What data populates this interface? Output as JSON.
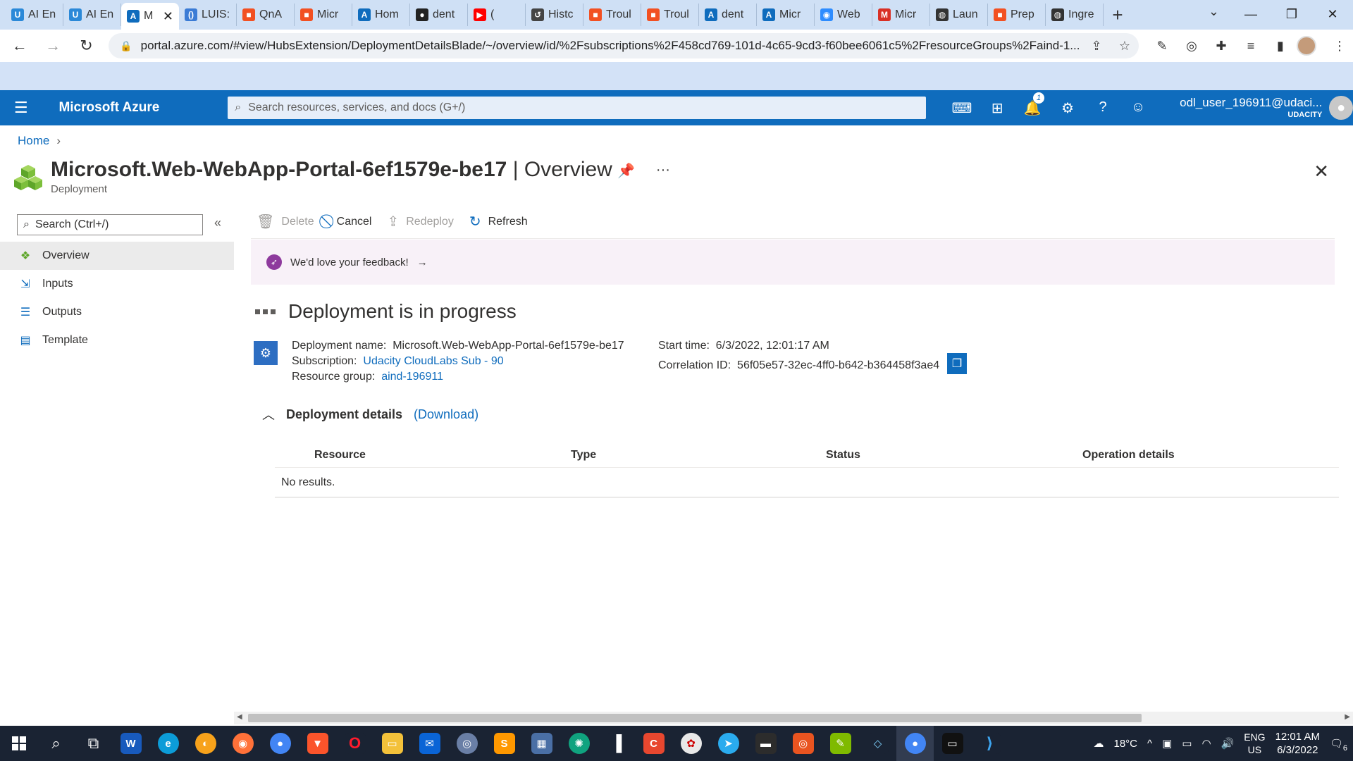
{
  "browser": {
    "tabs": [
      {
        "title": "AI En",
        "icon": "udacity-icon",
        "color": "#2b89d8",
        "glyph": "U"
      },
      {
        "title": "AI En",
        "icon": "udacity-icon",
        "color": "#2b89d8",
        "glyph": "U"
      },
      {
        "title": "M",
        "icon": "azure-icon",
        "color": "#0f6cbd",
        "glyph": "A",
        "active": true
      },
      {
        "title": "LUIS:",
        "icon": "luis-icon",
        "color": "#3a7bd5",
        "glyph": "()"
      },
      {
        "title": "QnA",
        "icon": "microsoft-icon",
        "color": "#f25022",
        "glyph": "■"
      },
      {
        "title": "Micr",
        "icon": "microsoft-icon",
        "color": "#f25022",
        "glyph": "■"
      },
      {
        "title": "Hom",
        "icon": "azure-icon",
        "color": "#0f6cbd",
        "glyph": "A"
      },
      {
        "title": "dent",
        "icon": "github-icon",
        "color": "#222222",
        "glyph": "●"
      },
      {
        "title": "(",
        "icon": "youtube-icon",
        "color": "#ff0000",
        "glyph": "▶"
      },
      {
        "title": "Histc",
        "icon": "history-icon",
        "color": "#444444",
        "glyph": "↺"
      },
      {
        "title": "Troul",
        "icon": "microsoft-icon",
        "color": "#f25022",
        "glyph": "■"
      },
      {
        "title": "Troul",
        "icon": "microsoft-icon",
        "color": "#f25022",
        "glyph": "■"
      },
      {
        "title": "dent",
        "icon": "azure-icon",
        "color": "#0f6cbd",
        "glyph": "A"
      },
      {
        "title": "Micr",
        "icon": "azure-icon",
        "color": "#0f6cbd",
        "glyph": "A"
      },
      {
        "title": "Web",
        "icon": "zoom-icon",
        "color": "#2d8cff",
        "glyph": "◉"
      },
      {
        "title": "Micr",
        "icon": "gmail-icon",
        "color": "#d93025",
        "glyph": "M"
      },
      {
        "title": "Laun",
        "icon": "globe-icon",
        "color": "#333333",
        "glyph": "◍"
      },
      {
        "title": "Prep",
        "icon": "microsoft-icon",
        "color": "#f25022",
        "glyph": "■"
      },
      {
        "title": "Ingre",
        "icon": "globe-icon",
        "color": "#333333",
        "glyph": "◍"
      }
    ],
    "url": "portal.azure.com/#view/HubsExtension/DeploymentDetailsBlade/~/overview/id/%2Fsubscriptions%2F458cd769-101d-4c65-9cd3-f60bee6061c5%2FresourceGroups%2Faind-1..."
  },
  "azure": {
    "brand": "Microsoft Azure",
    "search_placeholder": "Search resources, services, and docs (G+/)",
    "notification_count": "1",
    "user_name": "odl_user_196911@udaci...",
    "user_org": "UDACITY"
  },
  "breadcrumb": {
    "home": "Home"
  },
  "page": {
    "title_bold": "Microsoft.Web-WebApp-Portal-6ef1579e-be17",
    "title_rest": " | Overview",
    "subtitle": "Deployment"
  },
  "menu": {
    "search_placeholder": "Search (Ctrl+/)",
    "items": [
      {
        "label": "Overview",
        "icon": "overview-icon",
        "active": true
      },
      {
        "label": "Inputs",
        "icon": "inputs-icon"
      },
      {
        "label": "Outputs",
        "icon": "outputs-icon"
      },
      {
        "label": "Template",
        "icon": "template-icon"
      }
    ]
  },
  "commands": {
    "delete": "Delete",
    "cancel": "Cancel",
    "redeploy": "Redeploy",
    "refresh": "Refresh"
  },
  "feedback": {
    "text": "We'd love your feedback!",
    "arrow": "→"
  },
  "status": {
    "text": "Deployment is in progress"
  },
  "deployment": {
    "name_label": "Deployment name:",
    "name_value": "Microsoft.Web-WebApp-Portal-6ef1579e-be17",
    "subscription_label": "Subscription:",
    "subscription_value": "Udacity CloudLabs Sub - 90",
    "rg_label": "Resource group:",
    "rg_value": "aind-196911",
    "start_label": "Start time:",
    "start_value": "6/3/2022, 12:01:17 AM",
    "corr_label": "Correlation ID:",
    "corr_value": "56f05e57-32ec-4ff0-b642-b364458f3ae4"
  },
  "details": {
    "title": "Deployment details",
    "download": "(Download)",
    "columns": [
      "Resource",
      "Type",
      "Status",
      "Operation details"
    ],
    "empty": "No results."
  },
  "taskbar": {
    "weather": "18°C",
    "lang1": "ENG",
    "lang2": "US",
    "time": "12:01 AM",
    "date": "6/3/2022",
    "notif": "6"
  }
}
